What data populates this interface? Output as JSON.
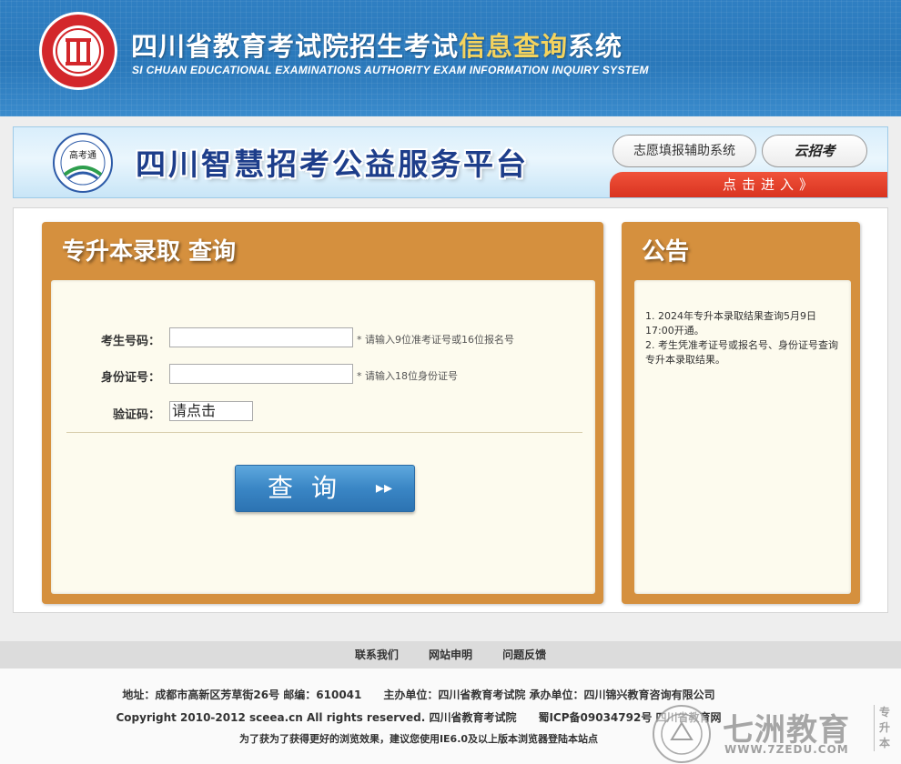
{
  "header": {
    "title_part1": "四川省教育考试院招生考试",
    "title_highlight": "信息查询",
    "title_part2": "系统",
    "subtitle": "SI CHUAN EDUCATIONAL EXAMINATIONS AUTHORITY EXAM INFORMATION INQUIRY SYSTEM",
    "logo_icon": "sceea-seal-icon"
  },
  "banner": {
    "title": "四川智慧招考公益服务平台",
    "logo_text": "高考通",
    "button_volunteer": "志愿填报辅助系统",
    "button_yunzhaokao": "云招考",
    "enter_label": "点击进入",
    "enter_arrow": "》"
  },
  "query_panel": {
    "title": "专升本录取 查询",
    "fields": [
      {
        "label": "考生号码：",
        "value": "",
        "hint": "* 请输入9位准考证号或16位报名号"
      },
      {
        "label": "身份证号：",
        "value": "",
        "hint": "* 请输入18位身份证号"
      }
    ],
    "captcha_label": "验证码：",
    "captcha_text": "请点击",
    "submit_label": "查询",
    "submit_arrow": "▸▸"
  },
  "notice_panel": {
    "title": "公告",
    "items": [
      "1. 2024年专升本录取结果查询5月9日17:00开通。",
      "2. 考生凭准考证号或报名号、身份证号查询专升本录取结果。"
    ]
  },
  "footer": {
    "nav": [
      "联系我们",
      "网站申明",
      "问题反馈"
    ],
    "address": "地址：成都市高新区芳草街26号 邮编：610041　　主办单位：四川省教育考试院 承办单位：四川锦兴教育咨询有限公司",
    "copyright": "Copyright 2010-2012 sceea.cn All rights reserved. 四川省教育考试院　　蜀ICP备09034792号 四川省教育网",
    "browser_tip": "为了获为了获得更好的浏览效果，建议您使用IE6.0及以上版本浏览器登陆本站点"
  },
  "watermark": {
    "text": "七洲教育",
    "url": "WWW.7ZEDU.COM",
    "side": "专升本"
  },
  "colors": {
    "header_blue": "#2f7fc2",
    "panel_orange": "#d5903e",
    "button_blue": "#3a86c5",
    "enter_red": "#e0402a"
  }
}
